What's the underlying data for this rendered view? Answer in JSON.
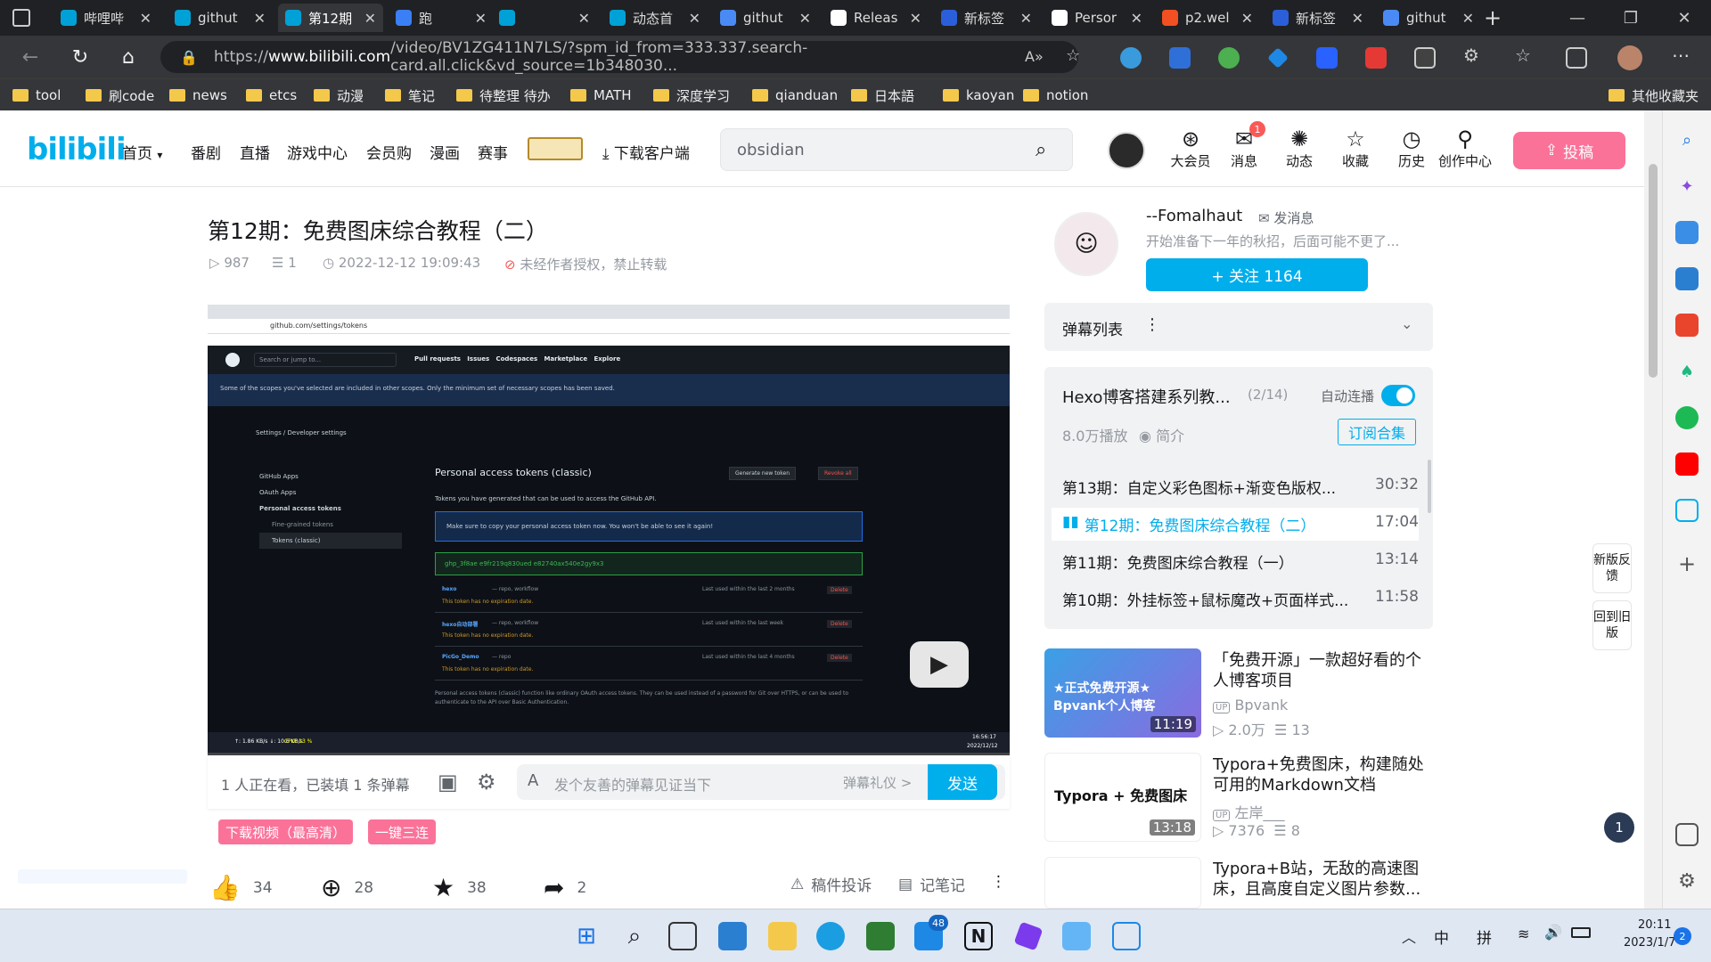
{
  "browser": {
    "tabs": [
      {
        "label": "哔哩哔",
        "color": "#00a1d6"
      },
      {
        "label": "githut",
        "color": "#00a1d6"
      },
      {
        "label": "第12期",
        "color": "#00a1d6"
      },
      {
        "label": "跑",
        "color": "#3a7ff6"
      },
      {
        "label": "",
        "color": "#00a1d6"
      },
      {
        "label": "动态首",
        "color": "#00a1d6"
      },
      {
        "label": "githut",
        "color": "#4a8af4"
      },
      {
        "label": "Releas",
        "color": "#ffffff"
      },
      {
        "label": "新标签",
        "color": "#2b5fd9"
      },
      {
        "label": "Persor",
        "color": "#ffffff"
      },
      {
        "label": "p2.wel",
        "color": "#f25022"
      },
      {
        "label": "新标签",
        "color": "#2b5fd9"
      },
      {
        "label": "githut",
        "color": "#4a8af4"
      }
    ],
    "url_prefix": "https://",
    "url_host": "www.bilibili.com",
    "url_rest": "/video/BV1ZG411N7LS/?spm_id_from=333.337.search-card.all.click&vd_source=1b348030...",
    "bookmarks": [
      "tool",
      "刷code",
      "news",
      "etcs",
      "动漫",
      "笔记",
      "待整理 待办",
      "MATH",
      "深度学习",
      "qianduan",
      "日本語",
      "kaoyan",
      "notion"
    ],
    "bookmarks_other": "其他收藏夹"
  },
  "header": {
    "logo": "bilibili",
    "nav": [
      "首页",
      "番剧",
      "直播",
      "游戏中心",
      "会员购",
      "漫画",
      "赛事"
    ],
    "download": "下载客户端",
    "search_value": "obsidian",
    "icons": [
      {
        "label": "大会员",
        "icon": "vip-icon"
      },
      {
        "label": "消息",
        "icon": "message-icon",
        "badge": "1"
      },
      {
        "label": "动态",
        "icon": "dynamic-icon"
      },
      {
        "label": "收藏",
        "icon": "star-icon"
      },
      {
        "label": "历史",
        "icon": "history-icon"
      },
      {
        "label": "创作中心",
        "icon": "creator-icon"
      }
    ],
    "upload": "投稿"
  },
  "video": {
    "title": "第12期：免费图床综合教程（二）",
    "views": "987",
    "danmaku": "1",
    "date": "2022-12-12 19:09:43",
    "copyright": "未经作者授权，禁止转载",
    "watching": "1 人正在看，已装填 1 条弹幕",
    "danmu_placeholder": "发个友善的弹幕见证当下",
    "danmu_etiquette": "弹幕礼仪 >",
    "send": "发送",
    "tag_download": "下载视频（最高清）",
    "tag_triple": "一键三连",
    "likes": "34",
    "coins": "28",
    "favorites": "38",
    "shares": "2",
    "report": "稿件投诉",
    "notes": "记笔记"
  },
  "player_screen": {
    "github_url": "github.com/settings/tokens",
    "nav": [
      "Pull requests",
      "Issues",
      "Codespaces",
      "Marketplace",
      "Explore"
    ],
    "search_placeholder": "Search or jump to...",
    "notice": "Some of the scopes you've selected are included in other scopes. Only the minimum set of necessary scopes has been saved.",
    "breadcrumb": "Settings / Developer settings",
    "side": [
      "GitHub Apps",
      "OAuth Apps",
      "Personal access tokens",
      "Fine-grained tokens",
      "Tokens (classic)"
    ],
    "heading": "Personal access tokens (classic)",
    "gen_btn": "Generate new token",
    "revoke_btn": "Revoke all",
    "desc": "Tokens you have generated that can be used to access the GitHub API.",
    "copy_note": "Make sure to copy your personal access token now. You won't be able to see it again!",
    "token": "ghp_3f8ae e9fr219q830ued e82740ax540e2gy9x3",
    "tokens": [
      {
        "name": "hexo",
        "scope": "— repo, workflow",
        "used": "Last used within the last 2 months"
      },
      {
        "name": "hexo自动部署",
        "scope": "— repo, workflow",
        "used": "Last used within the last week"
      },
      {
        "name": "PicGo_Demo",
        "scope": "— repo",
        "used": "Last used within the last 4 months"
      }
    ],
    "expiry": "This token has no expiration date.",
    "delete": "Delete",
    "footer": "Personal access tokens (classic) function like ordinary OAuth access tokens. They can be used instead of a password for Git over HTTPS, or can be used to authenticate to the API over Basic Authentication.",
    "tb_time": "16:56:17",
    "tb_date": "2022/12/12",
    "tb_net": "↑: 1.86 KB/s  ↓: 10.6 KB/s",
    "tb_cpu": "CPU: 13 %"
  },
  "uploader": {
    "name": "--Fomalhaut",
    "message": "发消息",
    "bio": "开始准备下一年的秋招，后面可能不更了...",
    "follow": "+ 关注 1164"
  },
  "danmu_list": {
    "label": "弹幕列表"
  },
  "playlist": {
    "title": "Hexo博客搭建系列教...",
    "progress": "(2/14)",
    "autoplay": "自动连播",
    "plays": "8.0万播放",
    "intro": "简介",
    "subscribe": "订阅合集",
    "episodes": [
      {
        "title": "第13期：自定义彩色图标+渐变色版权...",
        "dur": "30:32"
      },
      {
        "title": "第12期：免费图床综合教程（二）",
        "dur": "17:04",
        "current": true
      },
      {
        "title": "第11期：免费图床综合教程（一）",
        "dur": "13:14"
      },
      {
        "title": "第10期：外挂标签+鼠标魔改+页面样式...",
        "dur": "11:58"
      }
    ]
  },
  "recommend": [
    {
      "title": "「免费开源」一款超好看的个人博客项目",
      "up": "Bpvank",
      "views": "2.0万",
      "dm": "13",
      "dur": "11:19",
      "thumb_text": "★正式免费开源★ Bpvank个人博客"
    },
    {
      "title": "Typora+免费图床，构建随处可用的Markdown文档",
      "up": "左岸___",
      "views": "7376",
      "dm": "8",
      "dur": "13:18",
      "thumb_text": "Typora + 免费图床"
    },
    {
      "title": "Typora+B站，无敌的高速图床，且高度自定义图片参数...",
      "up": "",
      "views": "",
      "dm": "",
      "dur": "",
      "thumb_text": ""
    }
  ],
  "side_float": {
    "feedback": "新版反馈",
    "old": "回到旧版",
    "badge": "1"
  },
  "taskbar": {
    "ime1": "中",
    "ime2": "拼",
    "time": "20:11",
    "date": "2023/1/7",
    "notif": "2",
    "store_badge": "48"
  }
}
